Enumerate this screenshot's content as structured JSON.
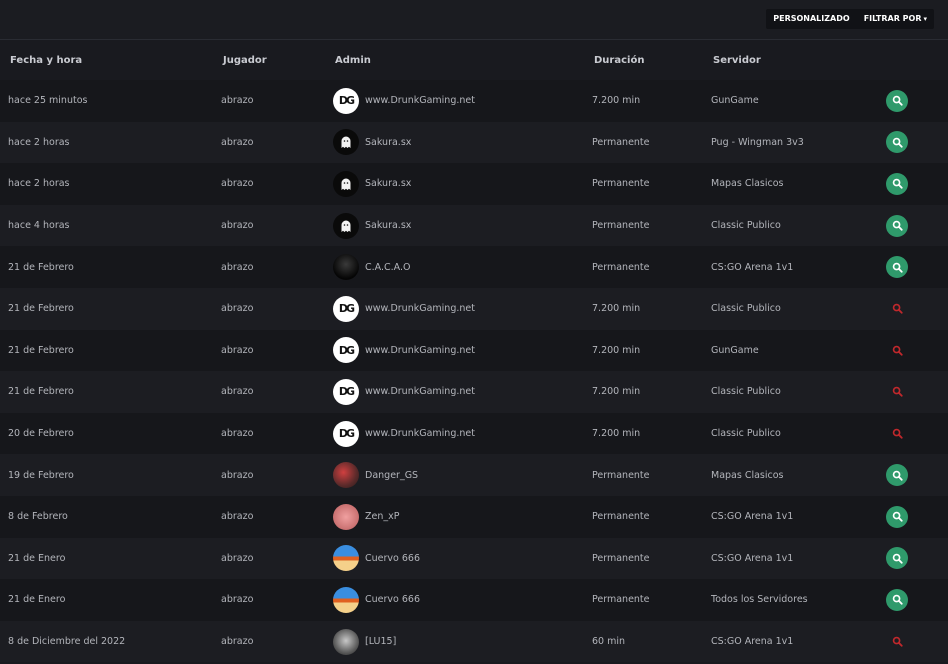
{
  "toolbar": {
    "custom_label": "PERSONALIZADO",
    "filter_label": "FILTRAR POR",
    "filter_caret": "▾"
  },
  "columns": [
    "Fecha y hora",
    "Jugador",
    "Admin",
    "Duración",
    "Servidor"
  ],
  "colors": {
    "active_button": "#2f9a6b",
    "expired_icon": "#c0282c"
  },
  "rows": [
    {
      "date": "hace 25 minutos",
      "player": "abrazo",
      "admin": "www.DrunkGaming.net",
      "avatar": "dg",
      "duration": "7.200 min",
      "server": "GunGame",
      "status": "active"
    },
    {
      "date": "hace 2 horas",
      "player": "abrazo",
      "admin": "Sakura.sx",
      "avatar": "ghost",
      "duration": "Permanente",
      "server": "Pug - Wingman 3v3",
      "status": "active"
    },
    {
      "date": "hace 2 horas",
      "player": "abrazo",
      "admin": "Sakura.sx",
      "avatar": "ghost",
      "duration": "Permanente",
      "server": "Mapas Clasicos",
      "status": "active"
    },
    {
      "date": "hace 4 horas",
      "player": "abrazo",
      "admin": "Sakura.sx",
      "avatar": "ghost",
      "duration": "Permanente",
      "server": "Classic Publico",
      "status": "active"
    },
    {
      "date": "21 de Febrero",
      "player": "abrazo",
      "admin": "C.A.C.A.O",
      "avatar": "dark",
      "duration": "Permanente",
      "server": "CS:GO Arena 1v1",
      "status": "active"
    },
    {
      "date": "21 de Febrero",
      "player": "abrazo",
      "admin": "www.DrunkGaming.net",
      "avatar": "dg",
      "duration": "7.200 min",
      "server": "Classic Publico",
      "status": "expired"
    },
    {
      "date": "21 de Febrero",
      "player": "abrazo",
      "admin": "www.DrunkGaming.net",
      "avatar": "dg",
      "duration": "7.200 min",
      "server": "GunGame",
      "status": "expired"
    },
    {
      "date": "21 de Febrero",
      "player": "abrazo",
      "admin": "www.DrunkGaming.net",
      "avatar": "dg",
      "duration": "7.200 min",
      "server": "Classic Publico",
      "status": "expired"
    },
    {
      "date": "20 de Febrero",
      "player": "abrazo",
      "admin": "www.DrunkGaming.net",
      "avatar": "dg",
      "duration": "7.200 min",
      "server": "Classic Publico",
      "status": "expired"
    },
    {
      "date": "19 de Febrero",
      "player": "abrazo",
      "admin": "Danger_GS",
      "avatar": "danger",
      "duration": "Permanente",
      "server": "Mapas Clasicos",
      "status": "active"
    },
    {
      "date": "8 de Febrero",
      "player": "abrazo",
      "admin": "Zen_xP",
      "avatar": "zen",
      "duration": "Permanente",
      "server": "CS:GO Arena 1v1",
      "status": "active"
    },
    {
      "date": "21 de Enero",
      "player": "abrazo",
      "admin": "Cuervo 666",
      "avatar": "cuervo",
      "duration": "Permanente",
      "server": "CS:GO Arena 1v1",
      "status": "active"
    },
    {
      "date": "21 de Enero",
      "player": "abrazo",
      "admin": "Cuervo 666",
      "avatar": "cuervo",
      "duration": "Permanente",
      "server": "Todos los Servidores",
      "status": "active"
    },
    {
      "date": "8 de Diciembre del 2022",
      "player": "abrazo",
      "admin": "[LU15]",
      "avatar": "lu",
      "duration": "60 min",
      "server": "CS:GO Arena 1v1",
      "status": "expired"
    }
  ]
}
